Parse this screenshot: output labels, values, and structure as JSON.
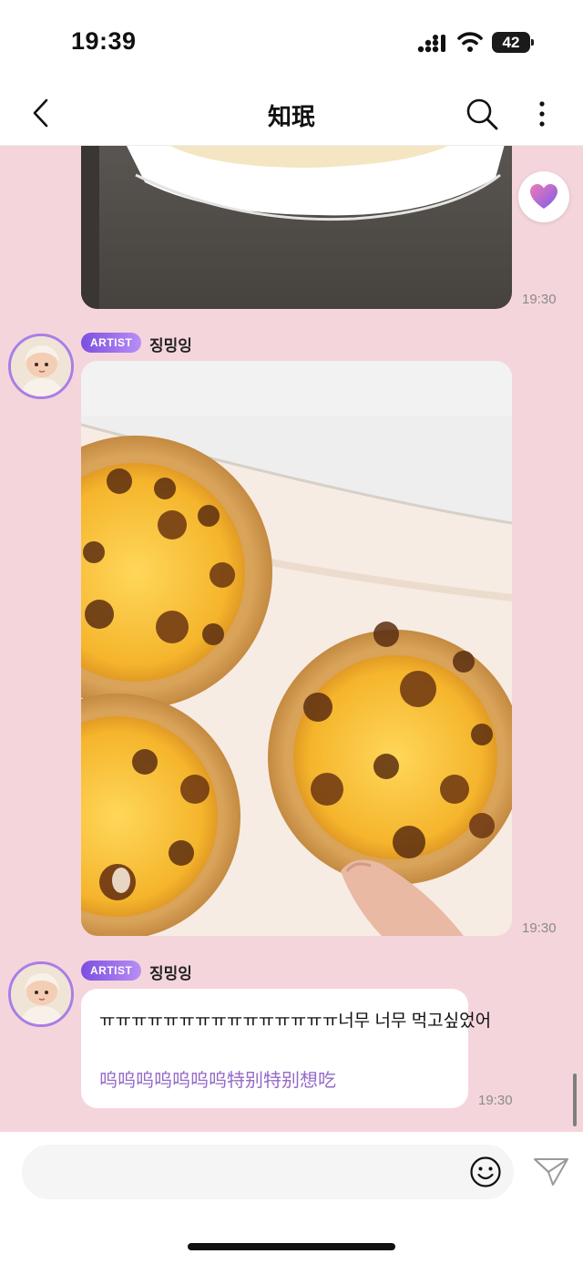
{
  "status_bar": {
    "time": "19:39",
    "battery": "42"
  },
  "header": {
    "title": "知珉"
  },
  "messages": [
    {
      "type": "photo",
      "timestamp": "19:30"
    },
    {
      "type": "photo",
      "badge": "ARTIST",
      "sender": "징밍잉",
      "timestamp": "19:30"
    },
    {
      "type": "text",
      "badge": "ARTIST",
      "sender": "징밍잉",
      "text": "ㅠㅠㅠㅠㅠㅠㅠㅠㅠㅠㅠㅠㅠㅠㅠ너무 너무 먹고싶었어",
      "translation": "呜呜呜呜呜呜呜特别特别想吃",
      "timestamp": "19:30"
    }
  ],
  "input": {
    "placeholder": ""
  },
  "icons": [
    "back-icon",
    "search-icon",
    "more-icon",
    "heart-icon",
    "emoji-icon",
    "send-icon"
  ],
  "colors": {
    "chat_background": "#f5d5dc",
    "artist_badge": "#8b5ce6",
    "translation_text": "#9569c6"
  }
}
